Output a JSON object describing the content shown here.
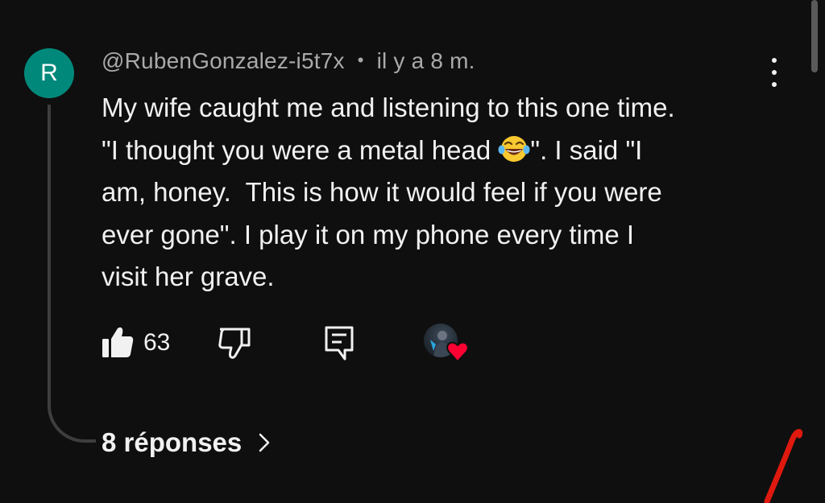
{
  "comment": {
    "avatar_letter": "R",
    "avatar_color": "#00897b",
    "author": "@RubenGonzalez-i5t7x",
    "separator": "•",
    "timestamp": "il y a 8 m.",
    "lines": [
      "My wife caught me and listening to this one time.",
      "\"I thought you were a metal head ",
      "\". I said \"I",
      "am, honey.  This is how it would feel if you were",
      "ever gone\". I play it on my phone every time I",
      "visit her grave."
    ],
    "emoji": "face-with-tears-of-joy"
  },
  "actions": {
    "like_count": "63",
    "like_icon": "thumbs-up-filled-icon",
    "dislike_icon": "thumbs-down-icon",
    "reply_icon": "reply-comment-icon",
    "creator_heart_color": "#ff0033"
  },
  "replies": {
    "label": "8 réponses"
  },
  "colors": {
    "background": "#0f0f0f",
    "text": "#f1f1f1",
    "meta": "#aaaaaa",
    "annotation": "#e0190f"
  }
}
